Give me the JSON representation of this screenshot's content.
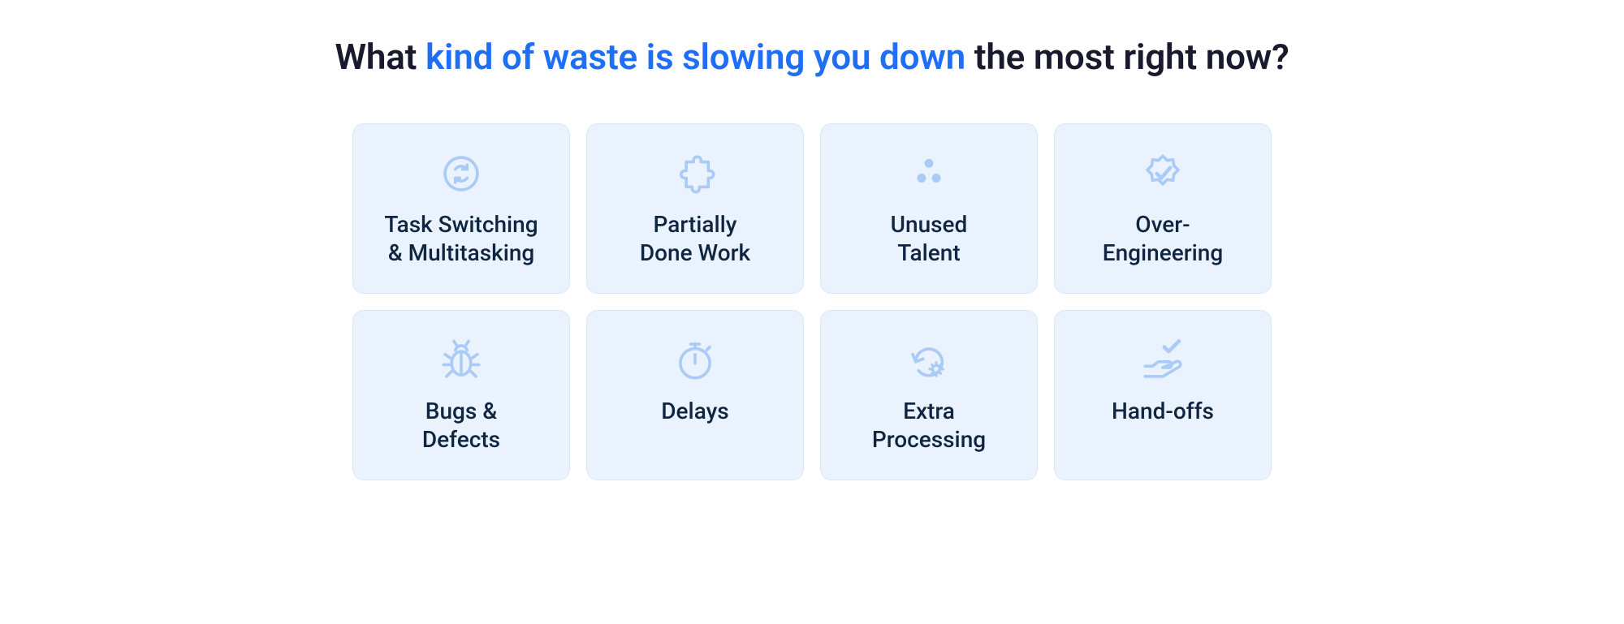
{
  "colors": {
    "card_bg": "#eaf2fe",
    "card_border": "#d7e6fb",
    "icon": "#a9cbf5",
    "text": "#0f2540",
    "accent": "#1e6ff5"
  },
  "heading": {
    "prefix": "What ",
    "highlight": "kind of waste is slowing you down",
    "suffix": " the most right now?"
  },
  "cards": [
    {
      "icon": "refresh-circle-icon",
      "label": "Task Switching\n& Multitasking"
    },
    {
      "icon": "puzzle-icon",
      "label": "Partially\nDone Work"
    },
    {
      "icon": "dots-icon",
      "label": "Unused\nTalent"
    },
    {
      "icon": "badge-check-icon",
      "label": "Over-\nEngineering"
    },
    {
      "icon": "bug-icon",
      "label": "Bugs &\nDefects"
    },
    {
      "icon": "stopwatch-icon",
      "label": "Delays"
    },
    {
      "icon": "history-gear-icon",
      "label": "Extra\nProcessing"
    },
    {
      "icon": "hand-check-icon",
      "label": "Hand-offs"
    }
  ]
}
